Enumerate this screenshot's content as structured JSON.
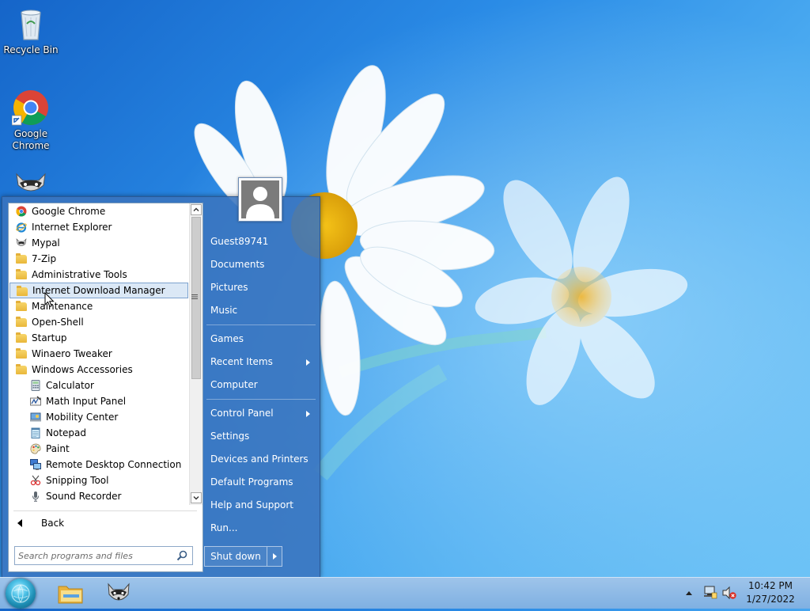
{
  "desktop": {
    "icons": [
      {
        "label": "Recycle Bin",
        "icon": "recycle-bin-icon"
      },
      {
        "label": "Google Chrome",
        "icon": "chrome-icon"
      },
      {
        "label": "",
        "icon": "raccoon-icon"
      }
    ]
  },
  "start_menu": {
    "programs": [
      {
        "label": "Google Chrome",
        "icon": "chrome-icon"
      },
      {
        "label": "Internet Explorer",
        "icon": "ie-icon"
      },
      {
        "label": "Mypal",
        "icon": "raccoon-icon"
      },
      {
        "label": "7-Zip",
        "icon": "folder-icon"
      },
      {
        "label": "Administrative Tools",
        "icon": "folder-icon"
      },
      {
        "label": "Internet Download Manager",
        "icon": "folder-icon"
      },
      {
        "label": "Maintenance",
        "icon": "folder-icon"
      },
      {
        "label": "Open-Shell",
        "icon": "folder-icon"
      },
      {
        "label": "Startup",
        "icon": "folder-icon"
      },
      {
        "label": "Winaero Tweaker",
        "icon": "folder-icon"
      },
      {
        "label": "Windows Accessories",
        "icon": "folder-icon"
      },
      {
        "label": "Calculator",
        "icon": "calculator-icon"
      },
      {
        "label": "Math Input Panel",
        "icon": "math-input-icon"
      },
      {
        "label": "Mobility Center",
        "icon": "mobility-center-icon"
      },
      {
        "label": "Notepad",
        "icon": "notepad-icon"
      },
      {
        "label": "Paint",
        "icon": "paint-icon"
      },
      {
        "label": "Remote Desktop Connection",
        "icon": "remote-desktop-icon"
      },
      {
        "label": "Snipping Tool",
        "icon": "snipping-tool-icon"
      },
      {
        "label": "Sound Recorder",
        "icon": "microphone-icon"
      }
    ],
    "back_label": "Back",
    "search_placeholder": "Search programs and files",
    "user_name": "Guest89741",
    "right_items": {
      "documents": "Documents",
      "pictures": "Pictures",
      "music": "Music",
      "games": "Games",
      "recent_items": "Recent Items",
      "computer": "Computer",
      "control_panel": "Control Panel",
      "settings": "Settings",
      "devices_printers": "Devices and Printers",
      "default_programs": "Default Programs",
      "help_support": "Help and Support",
      "run": "Run..."
    },
    "shutdown_label": "Shut down"
  },
  "taskbar": {
    "clock_time": "10:42 PM",
    "clock_date": "1/27/2022"
  },
  "colors": {
    "accent": "#3a74be",
    "highlight": "#dbe8f6"
  }
}
